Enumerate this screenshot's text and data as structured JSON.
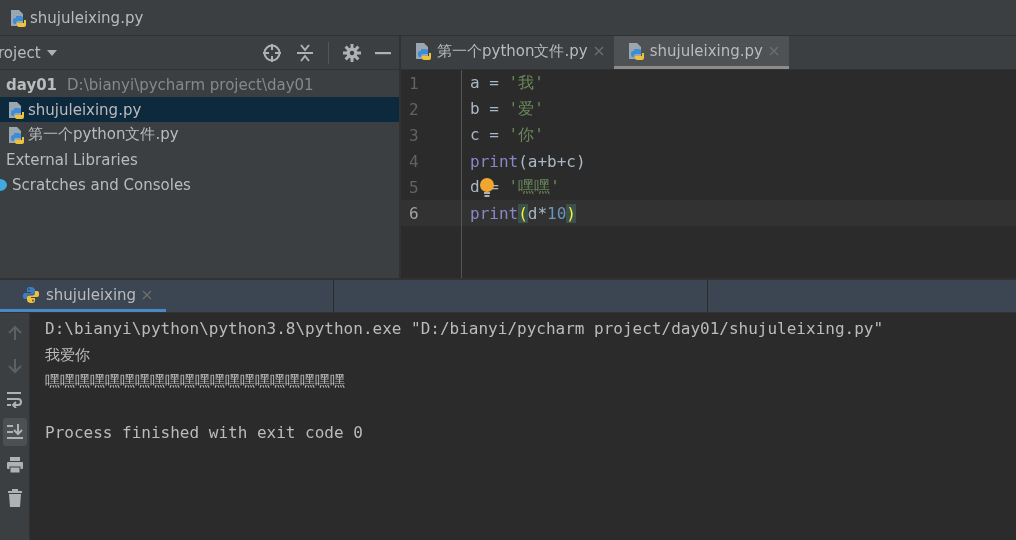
{
  "breadcrumb": {
    "file": "shujuleixing.py"
  },
  "project_panel": {
    "title": "roject",
    "tree": [
      {
        "label": "day01",
        "path": "D:\\bianyi\\pycharm project\\day01",
        "kind": "folder",
        "selected": false,
        "children": [
          {
            "label": "shujuleixing.py",
            "kind": "python",
            "selected": true
          },
          {
            "label": "第一个python文件.py",
            "kind": "python",
            "selected": false
          }
        ]
      },
      {
        "label": "External Libraries",
        "kind": "plain",
        "selected": false
      },
      {
        "label": "Scratches and Consoles",
        "kind": "scratch",
        "selected": false
      }
    ]
  },
  "editor": {
    "tabs": [
      {
        "label": "第一个python文件.py",
        "selected": false
      },
      {
        "label": "shujuleixing.py",
        "selected": true
      }
    ],
    "lines": [
      {
        "number": "1",
        "current": false,
        "tokens": [
          {
            "kind": "ident",
            "text": "a"
          },
          {
            "kind": "op",
            "text": " = "
          },
          {
            "kind": "string",
            "text": "'我'"
          }
        ]
      },
      {
        "number": "2",
        "current": false,
        "tokens": [
          {
            "kind": "ident",
            "text": "b"
          },
          {
            "kind": "op",
            "text": " = "
          },
          {
            "kind": "string",
            "text": "'爱'"
          }
        ]
      },
      {
        "number": "3",
        "current": false,
        "tokens": [
          {
            "kind": "ident",
            "text": "c"
          },
          {
            "kind": "op",
            "text": " = "
          },
          {
            "kind": "string",
            "text": "'你'"
          }
        ]
      },
      {
        "number": "4",
        "current": false,
        "tokens": [
          {
            "kind": "func",
            "text": "print"
          },
          {
            "kind": "op",
            "text": "(a+b+c)"
          }
        ]
      },
      {
        "number": "5",
        "current": false,
        "bulb": true,
        "tokens": [
          {
            "kind": "ident",
            "text": "d"
          },
          {
            "kind": "op",
            "text": " = "
          },
          {
            "kind": "string",
            "text": "'嘿嘿'"
          }
        ]
      },
      {
        "number": "6",
        "current": true,
        "tokens": [
          {
            "kind": "func",
            "text": "print"
          },
          {
            "kind": "match",
            "text": "("
          },
          {
            "kind": "ident",
            "text": "d"
          },
          {
            "kind": "op",
            "text": "*"
          },
          {
            "kind": "number",
            "text": "10"
          },
          {
            "kind": "match",
            "text": ")"
          }
        ]
      }
    ]
  },
  "run_panel": {
    "tabs": [
      {
        "label": "shujuleixing",
        "selected": true
      }
    ],
    "toolbar": [
      {
        "kind": "up",
        "disabled": true,
        "selected": false
      },
      {
        "kind": "down",
        "disabled": true,
        "selected": false
      },
      {
        "kind": "wrap",
        "disabled": false,
        "selected": false
      },
      {
        "kind": "scroll-end",
        "disabled": false,
        "selected": true
      },
      {
        "kind": "print",
        "disabled": false,
        "selected": false
      },
      {
        "kind": "trash",
        "disabled": false,
        "selected": false
      }
    ],
    "console_blocks": [
      [
        "D:\\bianyi\\python\\python3.8\\python.exe \"D:/bianyi/pycharm project/day01/shujuleixing.py\"",
        "我爱你",
        "嘿嘿嘿嘿嘿嘿嘿嘿嘿嘿嘿嘿嘿嘿嘿嘿嘿嘿嘿嘿"
      ],
      [
        "Process finished with exit code 0"
      ]
    ]
  }
}
